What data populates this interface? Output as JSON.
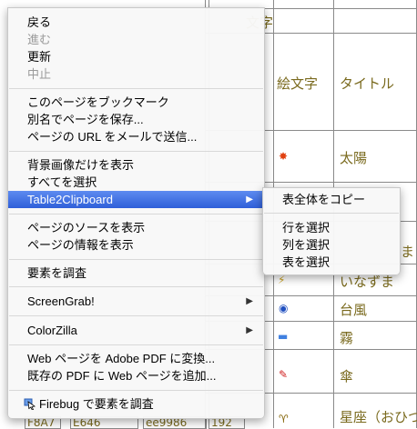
{
  "background_page": {
    "header_fragment": "文字",
    "column_emoji_header": "絵文字",
    "column_title_header": "タイトル",
    "rows": [
      {
        "title": "太陽",
        "icon": "sun-emoji-icon"
      },
      {
        "title": "ま",
        "icon": ""
      },
      {
        "title": "いなずま",
        "icon": "lightning-emoji-icon"
      },
      {
        "title": "台風",
        "icon": "typhoon-emoji-icon"
      },
      {
        "title": "霧",
        "icon": "fog-emoji-icon"
      },
      {
        "title": "傘",
        "icon": "umbrella-emoji-icon"
      },
      {
        "title": "星座（おひつ",
        "icon": "aries-emoji-icon"
      }
    ],
    "bottom_cells": [
      "F8A7",
      "E646",
      "ee9986",
      "192"
    ]
  },
  "context_menu": {
    "items": [
      {
        "label": "戻る",
        "enabled": true
      },
      {
        "label": "進む",
        "enabled": false
      },
      {
        "label": "更新",
        "enabled": true
      },
      {
        "label": "中止",
        "enabled": false
      },
      {
        "label": "このページをブックマーク",
        "enabled": true
      },
      {
        "label": "別名でページを保存...",
        "enabled": true
      },
      {
        "label": "ページの URL をメールで送信...",
        "enabled": true
      },
      {
        "label": "背景画像だけを表示",
        "enabled": true
      },
      {
        "label": "すべてを選択",
        "enabled": true
      },
      {
        "label": "Table2Clipboard",
        "enabled": true,
        "submenu": true,
        "highlighted": true
      },
      {
        "label": "ページのソースを表示",
        "enabled": true
      },
      {
        "label": "ページの情報を表示",
        "enabled": true
      },
      {
        "label": "要素を調査",
        "enabled": true
      },
      {
        "label": "ScreenGrab!",
        "enabled": true,
        "submenu": true
      },
      {
        "label": "ColorZilla",
        "enabled": true,
        "submenu": true
      },
      {
        "label": "Web ページを Adobe PDF に変換...",
        "enabled": true
      },
      {
        "label": "既存の PDF に Web ページを追加...",
        "enabled": true
      },
      {
        "label": "Firebug で要素を調査",
        "enabled": true,
        "icon": "firebug-icon"
      }
    ]
  },
  "submenu": {
    "items": [
      {
        "label": "表全体をコピー"
      },
      {
        "label": "行を選択"
      },
      {
        "label": "列を選択"
      },
      {
        "label": "表を選択"
      }
    ]
  },
  "colors": {
    "highlight": "#3a6ae0",
    "table_text": "#7a6a1e"
  }
}
